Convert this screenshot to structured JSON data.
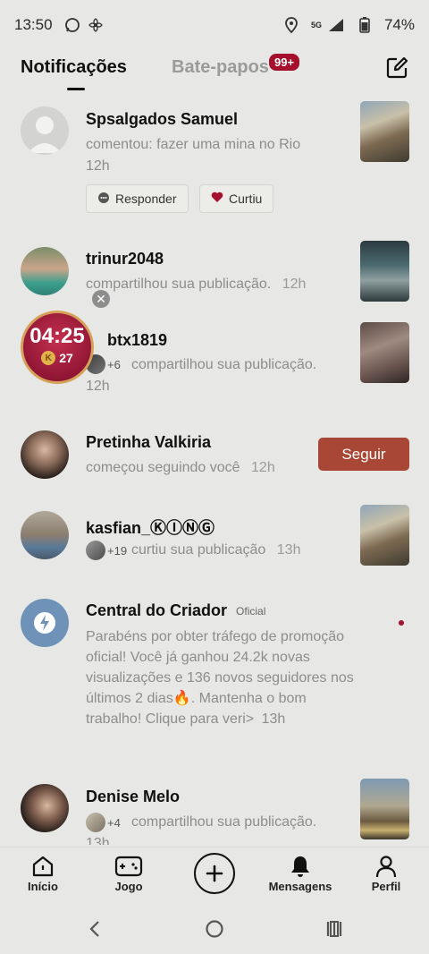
{
  "status_bar": {
    "time": "13:50",
    "battery": "74%",
    "network": "5G"
  },
  "header": {
    "tabs": [
      {
        "label": "Notificações",
        "active": true
      },
      {
        "label": "Bate-papos",
        "badge": "99+"
      }
    ]
  },
  "timer_widget": {
    "time": "04:25",
    "coins": "27",
    "coin_glyph": "K"
  },
  "notifications": [
    {
      "name": "Spsalgados Samuel",
      "text": "comentou: fazer uma mina no Rio",
      "time": "12h",
      "actions": [
        "Responder",
        "Curtiu"
      ]
    },
    {
      "name": "trinur2048",
      "text": "compartilhou sua publicação.",
      "time": "12h"
    },
    {
      "name": "btx1819",
      "extra_count": "+6",
      "text": "compartilhou sua publicação.",
      "time": "12h"
    },
    {
      "name": "Pretinha Valkiria",
      "text": "começou seguindo você",
      "time": "12h",
      "button": "Seguir"
    },
    {
      "name": "kasfian_ⓀⒾⓃⒼ",
      "extra_count": "+19",
      "text": "curtiu sua publicação",
      "time": "13h"
    },
    {
      "name": "Central do Criador",
      "tag": "Oficial",
      "text": "Parabéns por obter tráfego de promoção oficial! Você já ganhou 24.2k novas visualizações e 136 novos seguidores nos últimos 2 dias🔥. Mantenha o bom trabalho! Clique para veri>",
      "time": "13h"
    },
    {
      "name": "Denise Melo",
      "extra_count": "+4",
      "text": "compartilhou sua publicação.",
      "time": "13h"
    }
  ],
  "bottom_nav": [
    {
      "label": "Início"
    },
    {
      "label": "Jogo"
    },
    {
      "label": "Mensagens",
      "active": true
    },
    {
      "label": "Perfil"
    }
  ],
  "colors": {
    "accent": "#a5112c",
    "follow": "#a84735",
    "background": "#e7e7e5"
  }
}
